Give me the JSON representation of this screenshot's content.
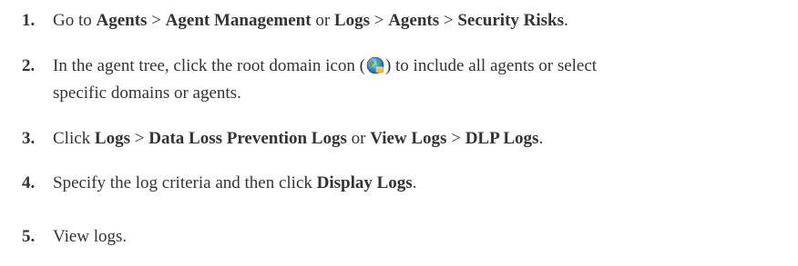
{
  "steps": [
    {
      "number": "1.",
      "parts": {
        "t1": "Go to ",
        "b1": "Agents",
        "t2": " > ",
        "b2": "Agent Management",
        "t3": " or ",
        "b3": "Logs",
        "t4": " > ",
        "b4": "Agents",
        "t5": " > ",
        "b5": "Security Risks",
        "t6": "."
      }
    },
    {
      "number": "2.",
      "parts": {
        "t1": "In the agent tree, click the root domain icon (",
        "icon": "root-domain-globe-icon",
        "t2": ") to include all agents or select",
        "t3": "specific domains or agents."
      }
    },
    {
      "number": "3.",
      "parts": {
        "t1": "Click ",
        "b1": "Logs",
        "t2": " > ",
        "b2": "Data Loss Prevention Logs",
        "t3": " or ",
        "b3": "View Logs",
        "t4": " > ",
        "b4": "DLP Logs",
        "t5": "."
      }
    },
    {
      "number": "4.",
      "parts": {
        "t1": "Specify the log criteria and then click ",
        "b1": "Display Logs",
        "t2": "."
      }
    },
    {
      "number": "5.",
      "parts": {
        "t1": "View logs."
      }
    }
  ],
  "colors": {
    "text": "#333333",
    "background": "#ffffff"
  }
}
